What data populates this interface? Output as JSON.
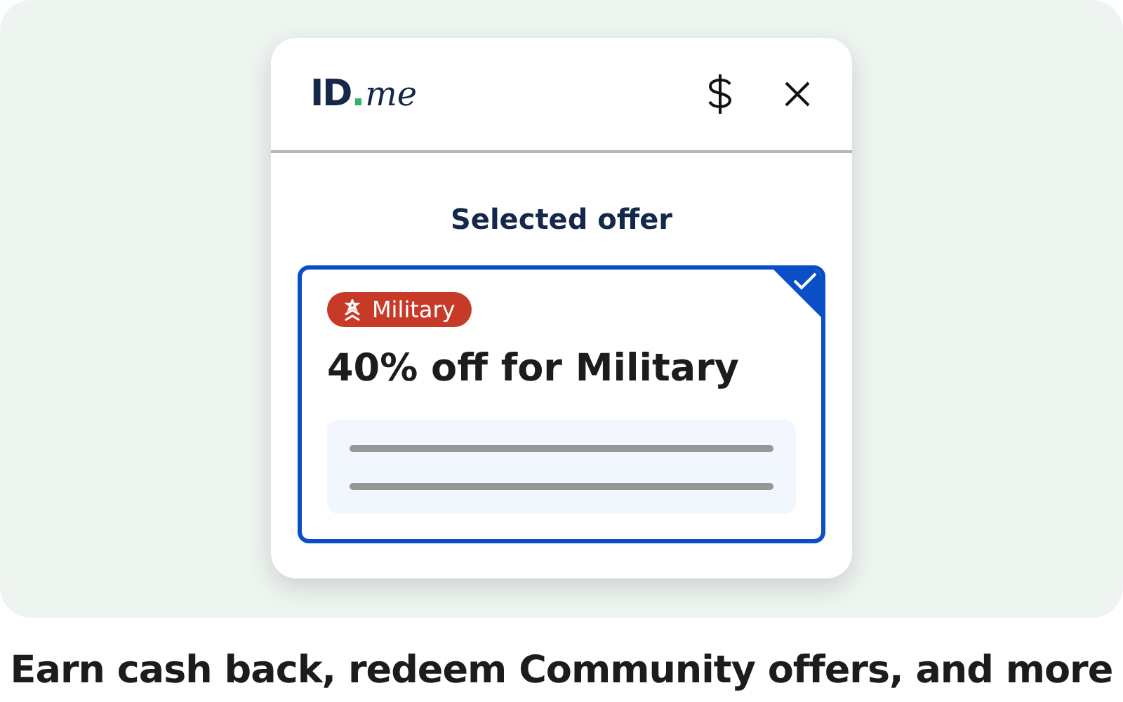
{
  "logo": {
    "main": "ID",
    "dot": ".",
    "suffix": "me"
  },
  "title": "Selected offer",
  "offer": {
    "selected": true,
    "tag": "Military",
    "headline": "40% off for Military"
  },
  "caption": "Earn cash back, redeem Community offers, and more"
}
